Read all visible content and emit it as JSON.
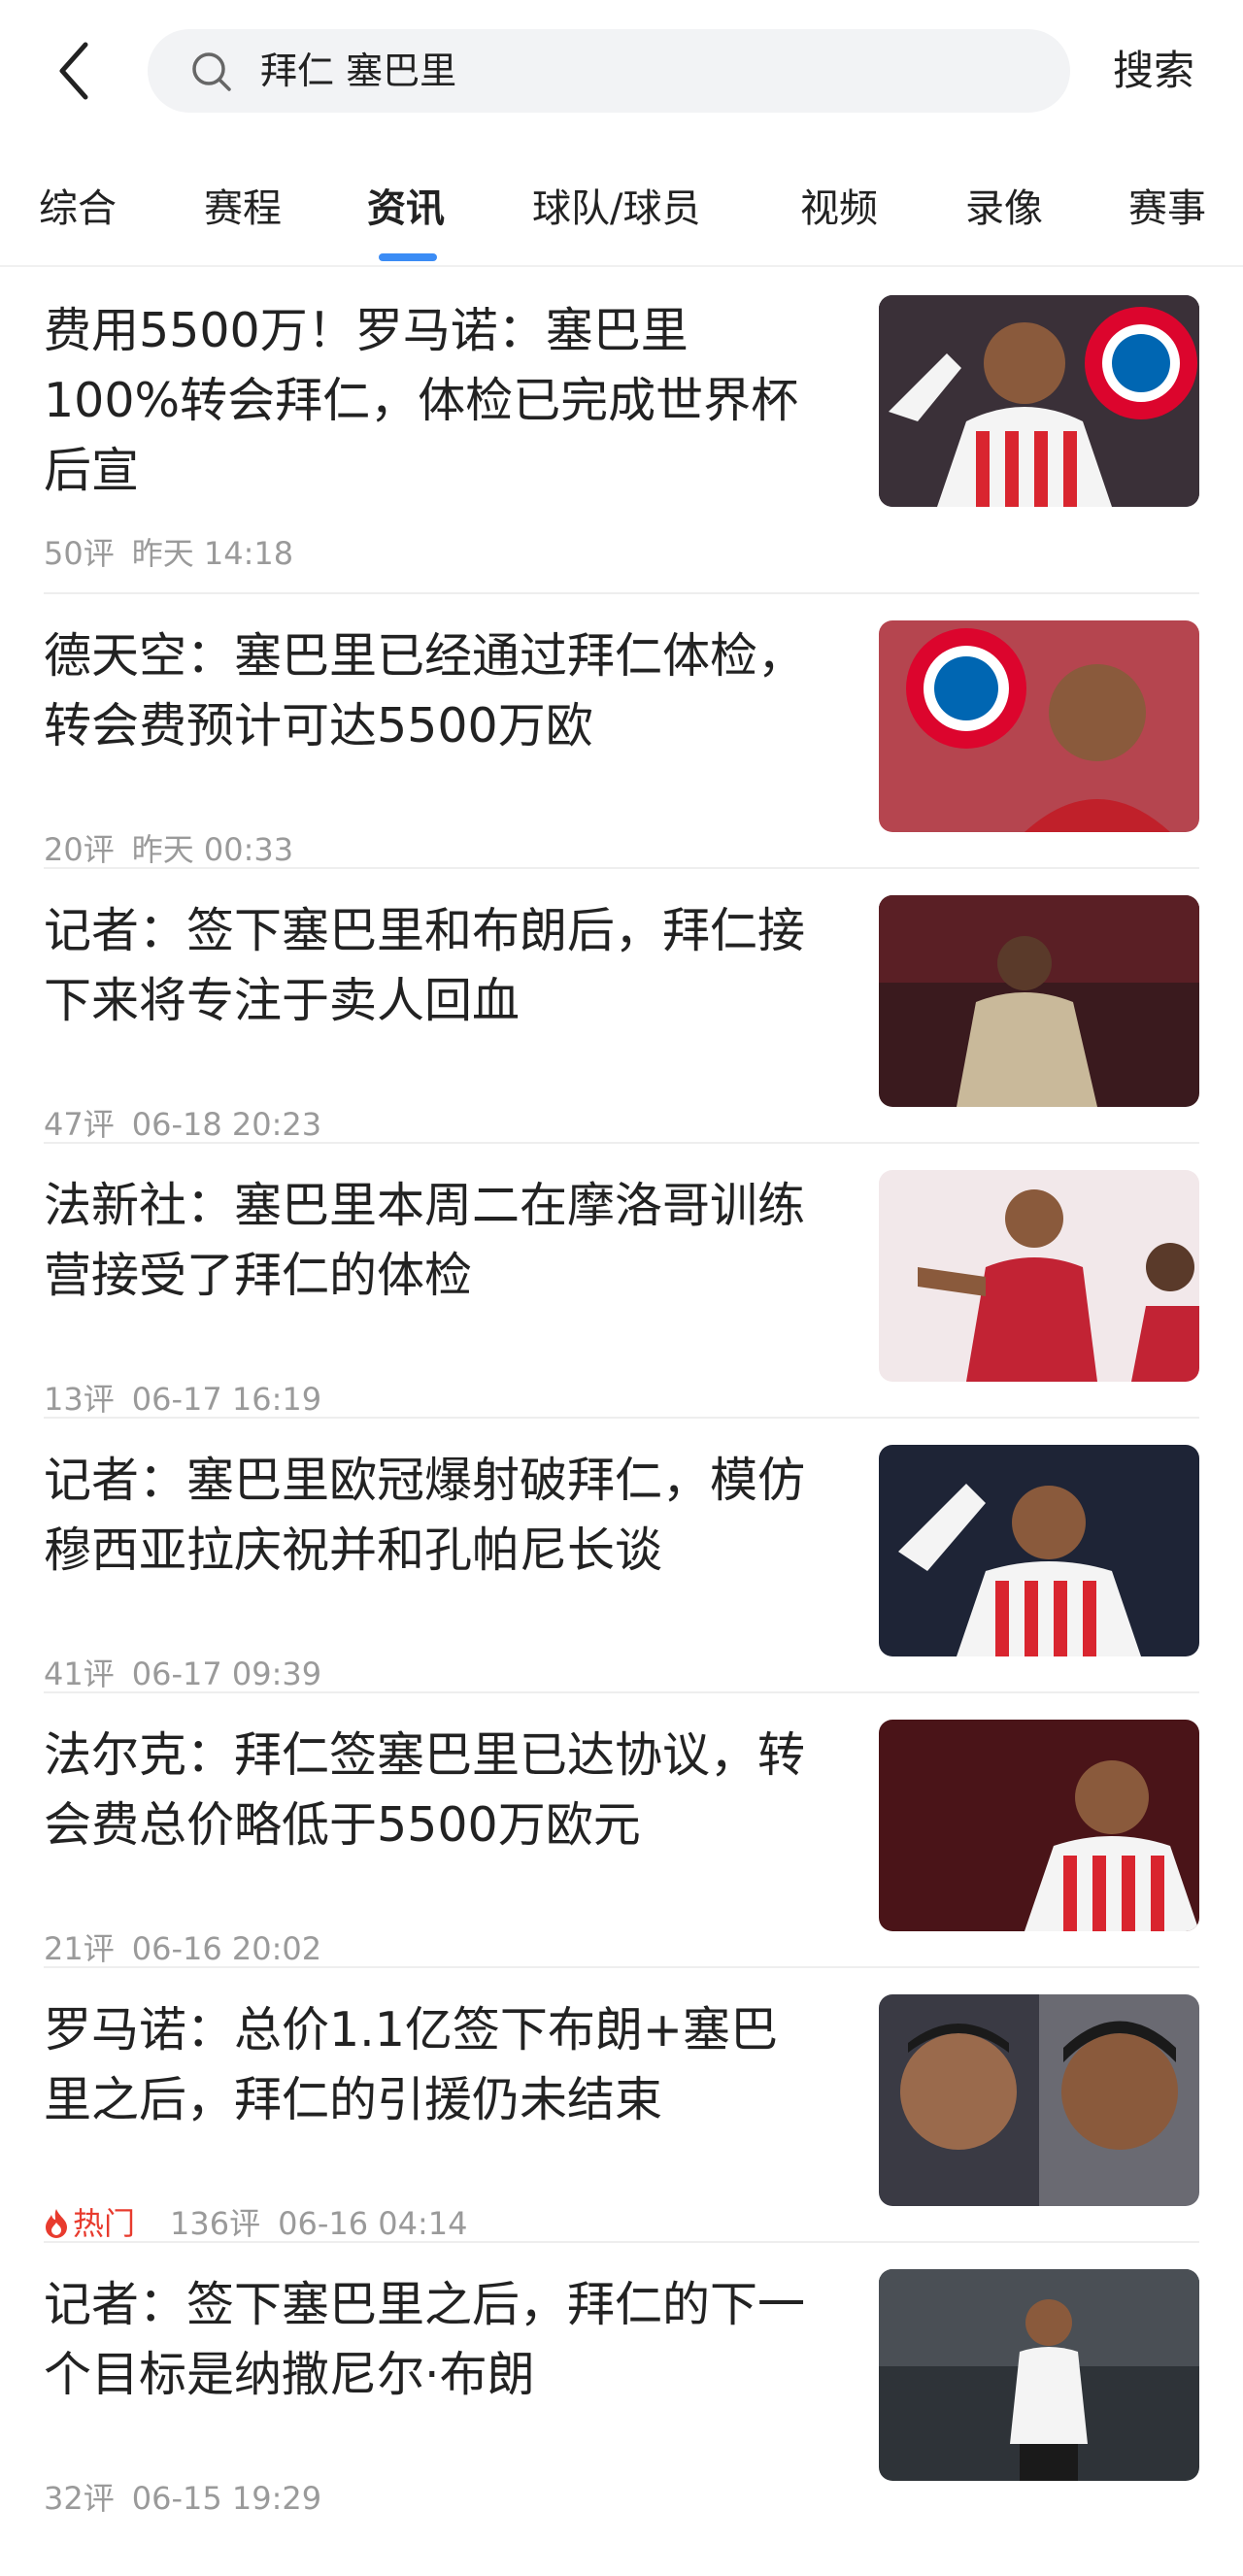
{
  "search": {
    "query": "拜仁 塞巴里",
    "button_label": "搜索"
  },
  "tabs": [
    {
      "label": "综合"
    },
    {
      "label": "赛程"
    },
    {
      "label": "资讯",
      "active": true
    },
    {
      "label": "球队/球员"
    },
    {
      "label": "视频"
    },
    {
      "label": "录像"
    },
    {
      "label": "赛事"
    }
  ],
  "articles": [
    {
      "title": "费用5500万！罗马诺：塞巴里100%转会拜仁，体检已完成世界杯后宣",
      "comments": "50评",
      "time": "昨天 14:18"
    },
    {
      "title": "德天空：塞巴里已经通过拜仁体检，转会费预计可达5500万欧",
      "comments": "20评",
      "time": "昨天 00:33"
    },
    {
      "title": "记者：签下塞巴里和布朗后，拜仁接下来将专注于卖人回血",
      "comments": "47评",
      "time": "06-18 20:23"
    },
    {
      "title": "法新社：塞巴里本周二在摩洛哥训练营接受了拜仁的体检",
      "comments": "13评",
      "time": "06-17 16:19"
    },
    {
      "title": "记者：塞巴里欧冠爆射破拜仁，模仿穆西亚拉庆祝并和孔帕尼长谈",
      "comments": "41评",
      "time": "06-17 09:39"
    },
    {
      "title": "法尔克：拜仁签塞巴里已达协议，转会费总价略低于5500万欧元",
      "comments": "21评",
      "time": "06-16 20:02"
    },
    {
      "title": "罗马诺：总价1.1亿签下布朗+塞巴里之后，拜仁的引援仍未结束",
      "hot_label": "热门",
      "comments": "136评",
      "time": "06-16 04:14"
    },
    {
      "title": "记者：签下塞巴里之后，拜仁的下一个目标是纳撒尼尔·布朗",
      "comments": "32评",
      "time": "06-15 19:29"
    }
  ],
  "colors": {
    "accent": "#3b8cf5",
    "hot": "#e83b2e",
    "meta": "#9a9a9a"
  },
  "icons": {
    "back": "chevron-left-icon",
    "search": "search-icon",
    "hot": "flame-icon"
  }
}
